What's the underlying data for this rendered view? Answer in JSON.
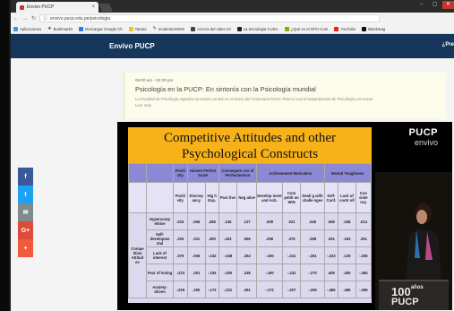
{
  "browser": {
    "tab_title": "Envivo PUCP",
    "tab_close": "×",
    "url": "envivo.pucp.edu.pe/psicologia",
    "bookmarks": [
      "Aplicaciones",
      "Bookmarks",
      "Descargar Google Ch",
      "Tareas",
      "moderatorMOS",
      "Acerca del video int",
      "La tecnologia CUDA",
      "¿Qué es el GPU Com",
      "YouTube",
      "Blackmag"
    ]
  },
  "site": {
    "brand": "Envivo PUCP",
    "header_right": "¿Pre"
  },
  "event": {
    "time": "09:00 am - 02:00 pm",
    "title": "Psicología en la PUCP: En sintonía con la Psicología mundial",
    "description": "La Facultad de Psicología organiza su evento central en el marco del Centenario PUCP. Para lo cual el Departamento de Psicología y la nueva",
    "more": "Leer más"
  },
  "social": [
    {
      "icon": "facebook-icon",
      "glyph": "f",
      "color": "#3b5998"
    },
    {
      "icon": "twitter-icon",
      "glyph": "t",
      "color": "#1da1f2"
    },
    {
      "icon": "email-icon",
      "glyph": "✉",
      "color": "#7f8c8d"
    },
    {
      "icon": "googleplus-icon",
      "glyph": "G+",
      "color": "#dd4b39"
    },
    {
      "icon": "more-icon",
      "glyph": "+",
      "color": "#f05a3a"
    }
  ],
  "video": {
    "slide_title_line1": "Competitive Attitudes and other",
    "slide_title_line2": "Psychological Constructs",
    "group_headers": [
      "Positi vity",
      "Absent Perfect Scale",
      "Consequen ces of Perfectionism",
      "Achievement Motivation",
      "Mental Toughness"
    ],
    "sub_headers": [
      "Positi vity",
      "Discrep ancy",
      "Hig h Exp.",
      "Posi tive",
      "Neg ative",
      "Develop ment and Ach.",
      "Com petiti on WIN",
      "Deali g with challe nges",
      "Self- Conf.",
      "Lack of contr oll",
      "Con siste ncy"
    ],
    "row_group_label": "Compe titive Attitud es",
    "rows": [
      {
        "label": "Hypercomp etitive",
        "values": [
          ".015",
          ".066",
          ".285",
          ".136",
          ".137",
          ".008",
          ".021",
          ".045",
          ".065",
          ".048",
          ".014"
        ]
      },
      {
        "label": "Self- developme ntal",
        "values": [
          ".204",
          ".011",
          ".290",
          ".433",
          ".066",
          ".298",
          ".375",
          ".298",
          ".301",
          ".163",
          ".251"
        ]
      },
      {
        "label": "Lack of interest",
        "values": [
          ".079",
          ".006",
          "-.242",
          "-.348",
          ".264",
          "-.190",
          "-.241",
          "-.261",
          "-.223",
          ".125",
          "-.206"
        ]
      },
      {
        "label": "Fear of losing",
        "values": [
          "-.223",
          ".251",
          "-.194",
          "-.250",
          ".338",
          "-.190",
          "-.242",
          "-.270",
          ".405",
          ".406",
          "-.384"
        ]
      },
      {
        "label": "Anxiety- driven",
        "values": [
          "-.229",
          ".290",
          "-.173",
          "-.221",
          ".361",
          "-.172",
          "-.207",
          "-.206",
          "-.466",
          ".466",
          "-.395"
        ]
      }
    ],
    "logo_line1": "PUCP",
    "logo_line2": "envivo",
    "podium_text": "100",
    "podium_sup": "años",
    "podium_text2": "PUCP"
  }
}
